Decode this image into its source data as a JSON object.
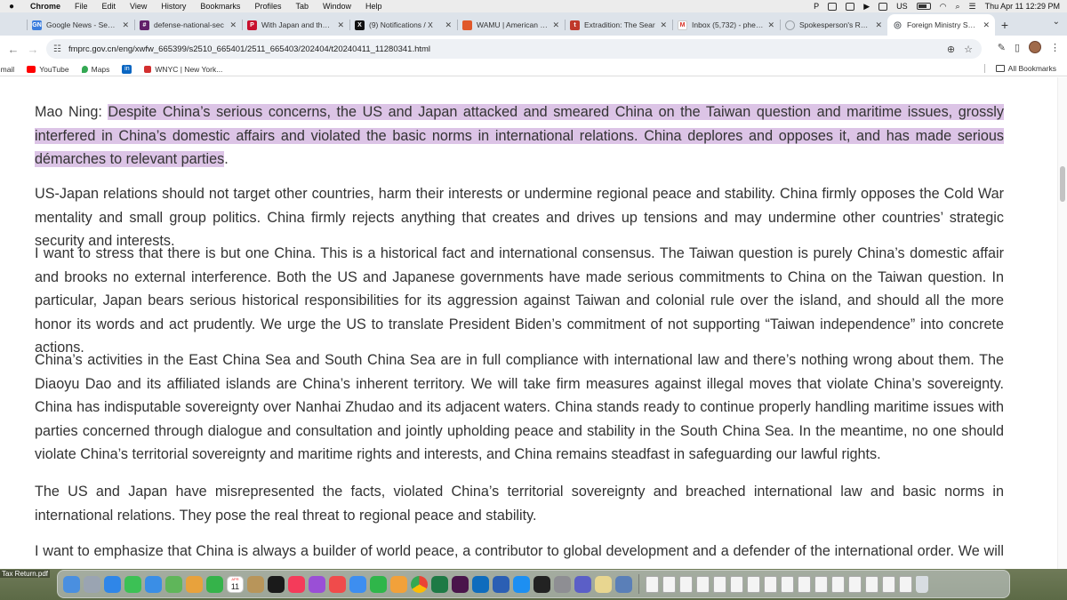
{
  "menubar": {
    "app": "Chrome",
    "items": [
      "File",
      "Edit",
      "View",
      "History",
      "Bookmarks",
      "Profiles",
      "Tab",
      "Window",
      "Help"
    ],
    "status_p": "P",
    "status_us": "US",
    "clock": "Thu Apr 11  12:29 PM"
  },
  "tabs": [
    {
      "title": "Google News - Searc",
      "icon": "google-news-icon",
      "color": "#3b7ddd",
      "glyph": "GN"
    },
    {
      "title": "defense-national-sec",
      "icon": "slack-icon",
      "color": "#611f69",
      "glyph": "#"
    },
    {
      "title": "With Japan and the Pl",
      "icon": "politico-icon",
      "color": "#c8102e",
      "glyph": "P"
    },
    {
      "title": "(9) Notifications / X",
      "icon": "x-icon",
      "color": "#111111",
      "glyph": "X"
    },
    {
      "title": "WAMU | American Un",
      "icon": "wamu-icon",
      "color": "#e0582a",
      "glyph": ""
    },
    {
      "title": "Extradition: The Sear",
      "icon": "podcast-icon",
      "color": "#c0392b",
      "glyph": "t"
    },
    {
      "title": "Inbox (5,732) - phekle",
      "icon": "gmail-icon",
      "color": "#ffffff",
      "glyph": "M"
    },
    {
      "title": "Spokesperson's Rem",
      "icon": "loading-icon",
      "color": "#9aa0a6",
      "glyph": ""
    },
    {
      "title": "Foreign Ministry Spok",
      "icon": "globe-icon",
      "color": "#5f6368",
      "glyph": "◎"
    }
  ],
  "url": "fmprc.gov.cn/eng/xwfw_665399/s2510_665401/2511_665403/202404/t20240411_11280341.html",
  "bookmarks": [
    {
      "label": "Gmail",
      "color": "#d93025"
    },
    {
      "label": "YouTube",
      "color": "#ff0000"
    },
    {
      "label": "Maps",
      "color": "#34a853"
    },
    {
      "label": "in",
      "color": "#0a66c2"
    },
    {
      "label": "WNYC | New York...",
      "color": "#d32f2f"
    }
  ],
  "all_bookmarks": "All Bookmarks",
  "article": {
    "p1_speaker": "Mao Ning: ",
    "p1_highlight": "Despite China’s serious concerns, the US and Japan attacked and smeared China on the Taiwan question and maritime issues, grossly interfered in China’s domestic affairs and violated the basic norms in international relations. China deplores and opposes it, and has made serious démarches to relevant parties",
    "p1_tail": ".",
    "p2": "US-Japan relations should not target other countries, harm their interests or undermine regional peace and stability. China firmly opposes the Cold War mentality and small group politics. China firmly rejects anything that creates and drives up tensions and may undermine other countries’ strategic security and interests.",
    "p3": "I want to stress that there is but one China. This is a historical fact and international consensus. The Taiwan question is purely China’s domestic affair and brooks no external interference. Both the US and Japanese governments have made serious commitments to China on the Taiwan question. In particular, Japan bears serious historical responsibilities for its aggression against Taiwan and colonial rule over the island, and should all the more honor its words and act prudently. We urge the US to translate President Biden’s commitment of not supporting “Taiwan independence” into concrete actions.",
    "p4": "China’s activities in the East China Sea and South China Sea are in full compliance with international law and there’s nothing wrong about them. The Diaoyu Dao and its affiliated islands are China’s inherent territory. We will take firm measures against illegal moves that violate China’s sovereignty. China has indisputable sovereignty over Nanhai Zhudao and its adjacent waters. China stands ready to continue properly handling maritime issues with parties concerned through dialogue and consultation and jointly upholding peace and stability in the South China Sea. In the meantime, no one should violate China’s territorial sovereignty and maritime rights and interests, and China remains steadfast in safeguarding our lawful rights.",
    "p5": "The US and Japan have misrepresented the facts, violated China’s territorial sovereignty and breached international law and basic norms in international relations. They pose the real threat to regional peace and stability.",
    "p6": "I want to emphasize that China is always a builder of world peace, a contributor to global development and a defender of the international order. We will never"
  },
  "desktop_file": "Tax Return.pdf",
  "dock": {
    "calendar_month": "APR",
    "calendar_day": "11",
    "apps": [
      {
        "name": "finder-icon",
        "color": "#4a8fe0"
      },
      {
        "name": "launchpad-icon",
        "color": "#9aa4b2"
      },
      {
        "name": "safari-icon",
        "color": "#2f86e8"
      },
      {
        "name": "messages-icon",
        "color": "#3cc155"
      },
      {
        "name": "mail-icon",
        "color": "#3a8ee6"
      },
      {
        "name": "maps-icon",
        "color": "#5fb65a"
      },
      {
        "name": "photos-icon",
        "color": "#e8a23c"
      },
      {
        "name": "facetime-icon",
        "color": "#35b34a"
      },
      {
        "name": "calendar-icon",
        "color": "#ffffff"
      },
      {
        "name": "notes-icon",
        "color": "#b8955a"
      },
      {
        "name": "tv-icon",
        "color": "#1a1a1a"
      },
      {
        "name": "music-icon",
        "color": "#f43b5a"
      },
      {
        "name": "podcasts-icon",
        "color": "#9a4fd6"
      },
      {
        "name": "news-icon",
        "color": "#f04b4b"
      },
      {
        "name": "keynote-icon",
        "color": "#3d8ef0"
      },
      {
        "name": "numbers-icon",
        "color": "#2fb64a"
      },
      {
        "name": "pages-icon",
        "color": "#f2a13a"
      },
      {
        "name": "chrome-icon",
        "color": "#f2c230"
      },
      {
        "name": "excel-icon",
        "color": "#1e7a45"
      },
      {
        "name": "slack-icon",
        "color": "#4a154b"
      },
      {
        "name": "outlook-icon",
        "color": "#0f6cbd"
      },
      {
        "name": "word-icon",
        "color": "#2b5fb4"
      },
      {
        "name": "app-store-icon",
        "color": "#1d8ff2"
      },
      {
        "name": "activity-monitor-icon",
        "color": "#222222"
      },
      {
        "name": "settings-icon",
        "color": "#8e8e93"
      },
      {
        "name": "teams-icon",
        "color": "#5b5fc7"
      },
      {
        "name": "preview-icon",
        "color": "#e8d690"
      },
      {
        "name": "screen-sharing-icon",
        "color": "#5a7fb8"
      }
    ],
    "docs_count": 16
  }
}
